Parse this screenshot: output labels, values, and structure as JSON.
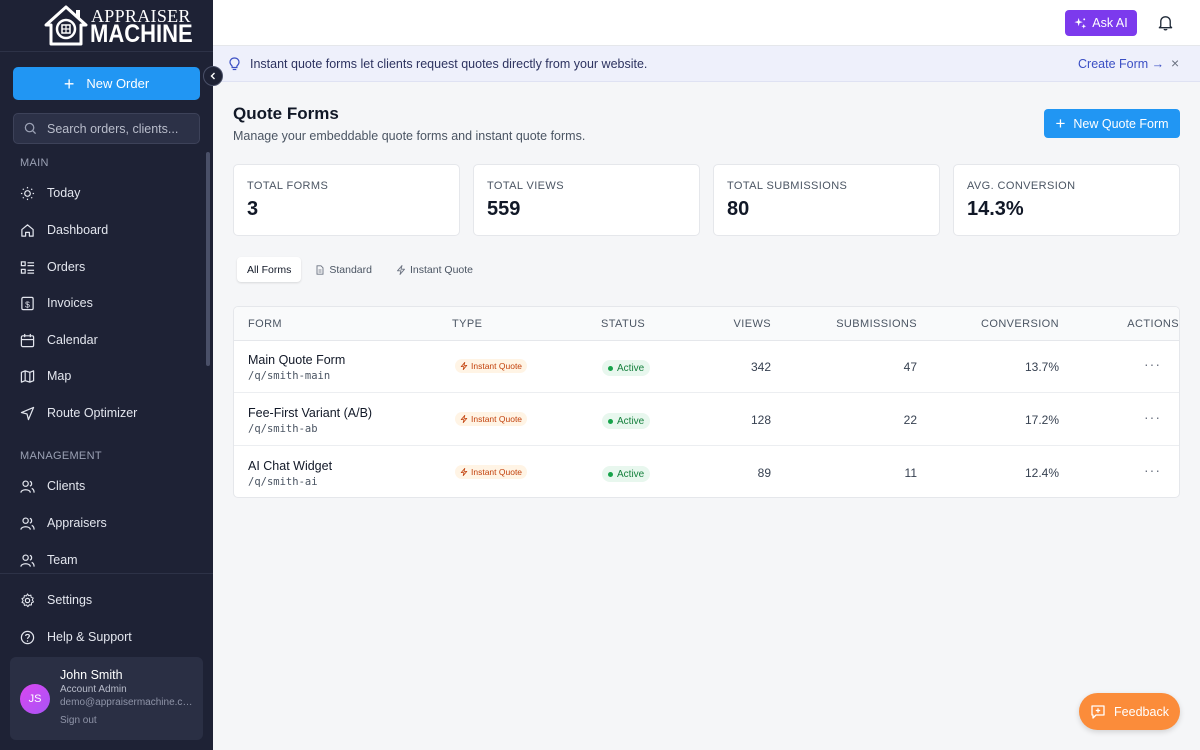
{
  "brand": {
    "line1": "APPRAISER",
    "line2": "MACHINE"
  },
  "sidebar": {
    "new_order_label": "New Order",
    "search_placeholder": "Search orders, clients...",
    "main_label": "MAIN",
    "main_items": [
      {
        "label": "Today",
        "icon": "sun-icon"
      },
      {
        "label": "Dashboard",
        "icon": "home-icon"
      },
      {
        "label": "Orders",
        "icon": "list-icon"
      },
      {
        "label": "Invoices",
        "icon": "invoice-icon"
      },
      {
        "label": "Calendar",
        "icon": "calendar-icon"
      },
      {
        "label": "Map",
        "icon": "map-icon"
      },
      {
        "label": "Route Optimizer",
        "icon": "navigation-icon"
      }
    ],
    "management_label": "MANAGEMENT",
    "management_items": [
      {
        "label": "Clients",
        "icon": "users-icon"
      },
      {
        "label": "Appraisers",
        "icon": "users-icon"
      },
      {
        "label": "Team",
        "icon": "users-icon"
      }
    ],
    "bottom_items": [
      {
        "label": "Settings",
        "icon": "gear-icon"
      },
      {
        "label": "Help & Support",
        "icon": "help-icon"
      }
    ],
    "user": {
      "initials": "JS",
      "name": "John Smith",
      "role": "Account Admin",
      "email": "demo@appraisermachine.com",
      "sign_out": "Sign out"
    }
  },
  "topbar": {
    "ask_ai_label": "Ask AI"
  },
  "banner": {
    "text": "Instant quote forms let clients request quotes directly from your website.",
    "link_label": "Create Form →",
    "close": "×"
  },
  "page": {
    "title": "Quote Forms",
    "subtitle": "Manage your embeddable quote forms and instant quote forms.",
    "new_button_label": "New Quote Form"
  },
  "stats": [
    {
      "label": "TOTAL FORMS",
      "value": "3"
    },
    {
      "label": "TOTAL VIEWS",
      "value": "559"
    },
    {
      "label": "TOTAL SUBMISSIONS",
      "value": "80"
    },
    {
      "label": "AVG. CONVERSION",
      "value": "14.3%"
    }
  ],
  "tabs": [
    {
      "label": "All Forms"
    },
    {
      "label": "Standard"
    },
    {
      "label": "Instant Quote"
    }
  ],
  "table": {
    "headers": [
      "FORM",
      "TYPE",
      "STATUS",
      "VIEWS",
      "SUBMISSIONS",
      "CONVERSION",
      "ACTIONS"
    ],
    "rows": [
      {
        "name": "Main Quote Form",
        "path": "/q/smith-main",
        "type": "Instant Quote",
        "status": "Active",
        "views": "342",
        "submissions": "47",
        "conversion": "13.7%",
        "actions": "···"
      },
      {
        "name": "Fee-First Variant (A/B)",
        "path": "/q/smith-ab",
        "type": "Instant Quote",
        "status": "Active",
        "views": "128",
        "submissions": "22",
        "conversion": "17.2%",
        "actions": "···"
      },
      {
        "name": "AI Chat Widget",
        "path": "/q/smith-ai",
        "type": "Instant Quote",
        "status": "Active",
        "views": "89",
        "submissions": "11",
        "conversion": "12.4%",
        "actions": "···"
      }
    ]
  },
  "feedback_label": "Feedback",
  "colors": {
    "sidebar_bg": "#1e2235",
    "primary": "#2196f3",
    "ai": "#7c3aed",
    "feedback": "#fb8c3a"
  }
}
